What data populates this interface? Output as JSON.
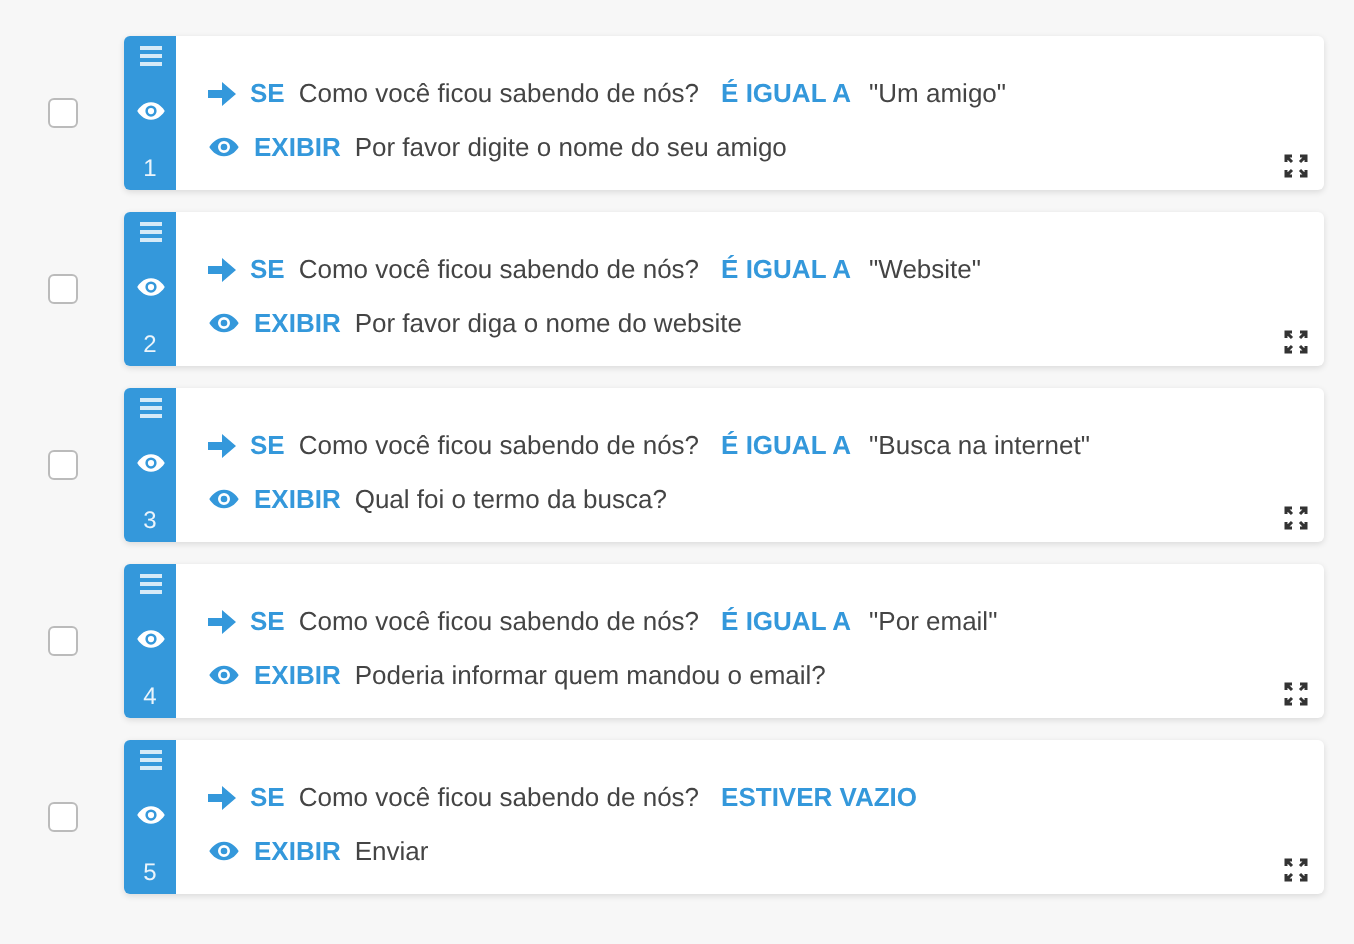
{
  "rules": [
    {
      "checked": false,
      "number": "1",
      "if_label": "SE",
      "question": "Como você ficou sabendo de nós?",
      "operator": "É IGUAL A",
      "value": "\"Um amigo\"",
      "action": "EXIBIR",
      "target": "Por favor digite o nome do seu amigo"
    },
    {
      "checked": false,
      "number": "2",
      "if_label": "SE",
      "question": "Como você ficou sabendo de nós?",
      "operator": "É IGUAL A",
      "value": "\"Website\"",
      "action": "EXIBIR",
      "target": "Por favor diga o nome do website"
    },
    {
      "checked": false,
      "number": "3",
      "if_label": "SE",
      "question": "Como você ficou sabendo de nós?",
      "operator": "É IGUAL A",
      "value": "\"Busca na internet\"",
      "action": "EXIBIR",
      "target": "Qual foi o termo da busca?"
    },
    {
      "checked": false,
      "number": "4",
      "if_label": "SE",
      "question": "Como você ficou sabendo de nós?",
      "operator": "É IGUAL A",
      "value": "\"Por email\"",
      "action": "EXIBIR",
      "target": "Poderia informar quem mandou o email?"
    },
    {
      "checked": false,
      "number": "5",
      "if_label": "SE",
      "question": "Como você ficou sabendo de nós?",
      "operator": "ESTIVER VAZIO",
      "action": "EXIBIR",
      "target": "Enviar"
    }
  ]
}
